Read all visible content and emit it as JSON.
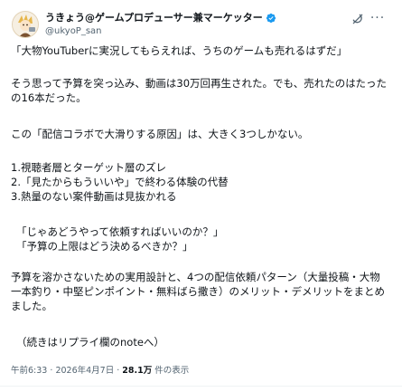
{
  "post": {
    "display_name": "うきょう@ゲームプロデューサー兼マーケッター",
    "handle": "@ukyoP_san",
    "paragraphs": [
      "「大物YouTuberに実況してもらえれば、うちのゲームも売れるはずだ」",
      "そう思って予算を突っ込み、動画は30万回再生された。でも、売れたのはたったの16本だった。",
      "この「配信コラボで大滑りする原因」は、大きく3つしかない。",
      "1.視聴者層とターゲット層のズレ\n2.「見たからもういいや」で終わる体験の代替\n3.熱量のない案件動画は見抜かれる",
      "「じゃあどうやって依頼すればいいのか？」\n「予算の上限はどう決めるべきか？」",
      "予算を溶かさないための実用設計と、4つの配信依頼パターン（大量投稿・大物一本釣り・中堅ピンポイント・無料ばら撒き）のメリット・デメリットをまとめました。",
      "（続きはリプライ欄のnoteへ）"
    ],
    "time": "午前6:33",
    "separator": "·",
    "date": "2026年4月7日",
    "views_count": "28.1万",
    "views_label": "件の表示"
  },
  "icons": {
    "avatar": "avatar-character-icon",
    "verified": "verified-badge-icon",
    "grok": "grok-icon",
    "more": "more-options-icon"
  },
  "colors": {
    "verified_blue": "#1d9bf0",
    "secondary_text": "#536471",
    "primary_text": "#0f1419"
  }
}
